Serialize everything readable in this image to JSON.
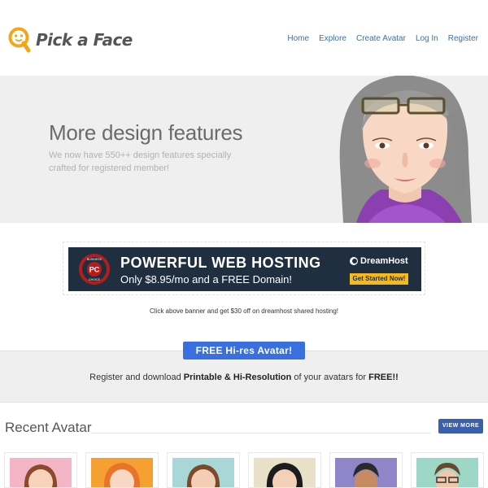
{
  "logo": {
    "text": "Pick a Face"
  },
  "nav": {
    "items": [
      "Home",
      "Explore",
      "Create Avatar",
      "Log In",
      "Register"
    ]
  },
  "hero": {
    "title": "More design features",
    "subtitle": "We now have 550++ design features specially crafted for registered member!"
  },
  "banner": {
    "badge_top": "BUSINESS",
    "badge_mid": "PC",
    "badge_bottom": "CHOICE",
    "title": "POWERFUL WEB HOSTING",
    "sub": "Only $8.95/mo and a FREE Domain!",
    "brand": "DreamHost",
    "cta": "Get Started Now!",
    "caption": "Click above banner and get $30 off on dreamhost shared hosting!"
  },
  "free": {
    "button": "FREE Hi-res Avatar!",
    "text_pre": "Register and download ",
    "text_bold": "Printable & Hi-Resolution",
    "text_mid": " of your avatars for ",
    "text_end": "FREE!!"
  },
  "recent": {
    "title": "Recent Avatar",
    "view_more": "VIEW MORE",
    "thumb_colors": [
      "#f4b6c6",
      "#f7a032",
      "#a9d6d6",
      "#e8e0c8",
      "#8e86c8",
      "#9dd8c6"
    ]
  },
  "colors": {
    "accent": "#3a6fe0",
    "link": "#3a6fb3",
    "logo_orange": "#f2a71b"
  }
}
